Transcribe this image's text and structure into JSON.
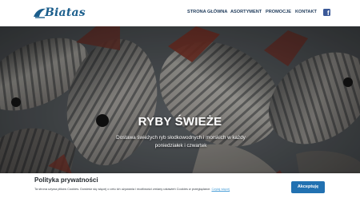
{
  "brand": {
    "name": "Biatas"
  },
  "nav": {
    "items": [
      "STRONA GŁÓWNA",
      "ASORTYMENT",
      "PROMOCJE",
      "KONTAKT"
    ],
    "social_icon": "facebook-icon"
  },
  "hero": {
    "title": "RYBY ŚWIEŻE",
    "subtitle": "Dostawa świeżych ryb słodkowodnych i morskich w każdy poniedziałek i czwartek"
  },
  "cookie": {
    "title": "Polityka prywatności",
    "text": "Ta strona używa plików Cookies. Dowiedz się więcej o celu ich używania i możliwości zmiany ustawień Cookies w przeglądarce.",
    "link": "Czytaj więcej",
    "accept_label": "Akceptuję"
  },
  "colors": {
    "brand_blue": "#1b5e8c",
    "nav_text": "#1e3a5a",
    "facebook": "#3b5998",
    "accept_button": "#2271b1",
    "link": "#4a9fd8"
  }
}
